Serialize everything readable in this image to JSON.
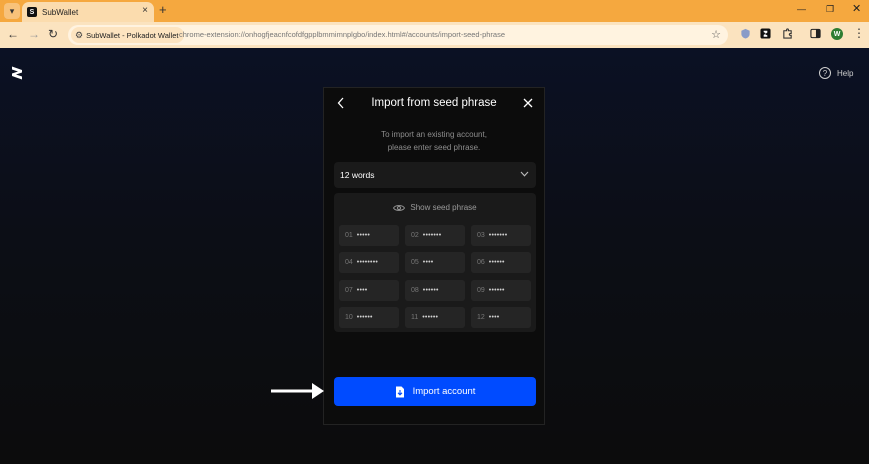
{
  "browser": {
    "tab_title": "SubWallet",
    "tab_favicon_letter": "S",
    "tab_close": "×",
    "new_tab": "+",
    "site_chip": "SubWallet - Polkadot Wallet",
    "url": "chrome-extension://onhogfjeacnfcofdfgpplbmmimnplgbo/index.html#/accounts/import-seed-phrase",
    "profile_initial": "W",
    "accent_color": "#f5a83f"
  },
  "header": {
    "help_label": "Help",
    "help_icon_glyph": "?"
  },
  "panel": {
    "title": "Import from seed phrase",
    "subtitle_line1": "To import an existing account,",
    "subtitle_line2": "please enter seed phrase.",
    "word_count": "12 words",
    "show_seed_label": "Show seed phrase",
    "words": [
      {
        "idx": "01",
        "masked": "•••••"
      },
      {
        "idx": "02",
        "masked": "•••••••"
      },
      {
        "idx": "03",
        "masked": "•••••••"
      },
      {
        "idx": "04",
        "masked": "••••••••"
      },
      {
        "idx": "05",
        "masked": "••••"
      },
      {
        "idx": "06",
        "masked": "••••••"
      },
      {
        "idx": "07",
        "masked": "••••"
      },
      {
        "idx": "08",
        "masked": "••••••"
      },
      {
        "idx": "09",
        "masked": "••••••"
      },
      {
        "idx": "10",
        "masked": "••••••"
      },
      {
        "idx": "11",
        "masked": "••••••"
      },
      {
        "idx": "12",
        "masked": "••••"
      }
    ],
    "import_button_label": "Import account",
    "primary_color": "#004bff"
  }
}
